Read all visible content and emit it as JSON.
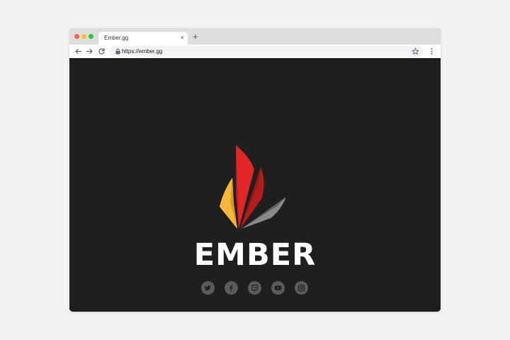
{
  "browser": {
    "tab": {
      "title": "Ember.gg",
      "close_glyph": "×"
    },
    "new_tab_glyph": "+",
    "address_bar": {
      "url": "https://ember.gg"
    },
    "icons": [
      "arrow-left-icon",
      "arrow-right-icon",
      "reload-icon",
      "lock-icon",
      "star-icon",
      "kebab-menu-icon"
    ],
    "traffic_lights": {
      "close": "#ff5f57",
      "minimize": "#febc2e",
      "maximize": "#28c840"
    }
  },
  "page": {
    "background": "#1f1f1f",
    "brand_name": "EMBER",
    "logo_colors": [
      "#f5b73b",
      "#e02626",
      "#b51d1d",
      "#8a8a8a"
    ],
    "social_links": [
      {
        "name": "twitter-icon"
      },
      {
        "name": "facebook-icon"
      },
      {
        "name": "twitch-icon"
      },
      {
        "name": "youtube-icon"
      },
      {
        "name": "instagram-icon"
      }
    ]
  }
}
